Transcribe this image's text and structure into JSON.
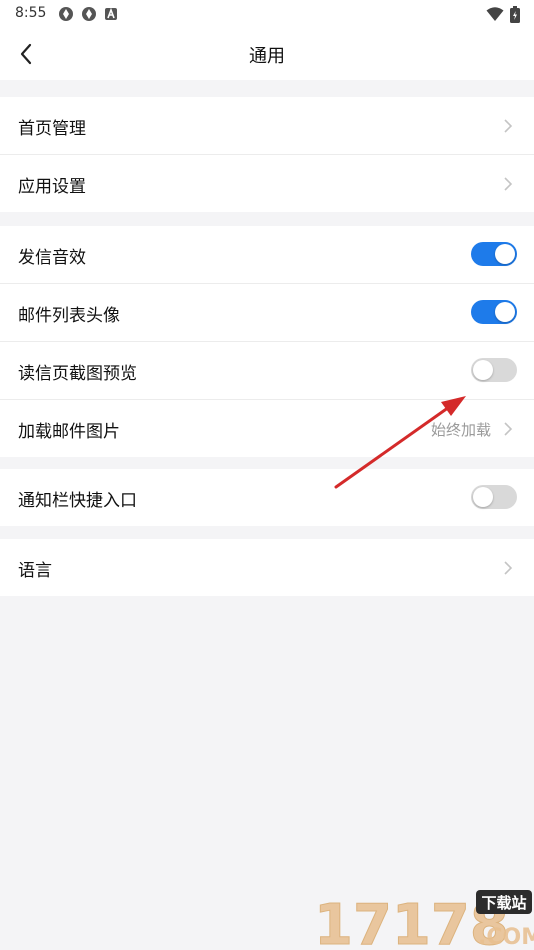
{
  "status_bar": {
    "time": "8:55",
    "left_icons": [
      "app-icon",
      "app-icon",
      "notification-a-icon"
    ],
    "right_icons": [
      "wifi-icon",
      "battery-icon"
    ]
  },
  "header": {
    "title": "通用",
    "back_icon": "chevron-left-icon"
  },
  "groups": [
    {
      "rows": [
        {
          "label": "首页管理",
          "type": "nav"
        },
        {
          "label": "应用设置",
          "type": "nav"
        }
      ]
    },
    {
      "rows": [
        {
          "label": "发信音效",
          "type": "toggle",
          "on": true
        },
        {
          "label": "邮件列表头像",
          "type": "toggle",
          "on": true
        },
        {
          "label": "读信页截图预览",
          "type": "toggle",
          "on": false
        },
        {
          "label": "加载邮件图片",
          "type": "nav",
          "value": "始终加载"
        }
      ]
    },
    {
      "rows": [
        {
          "label": "通知栏快捷入口",
          "type": "toggle",
          "on": false
        }
      ]
    },
    {
      "rows": [
        {
          "label": "语言",
          "type": "nav"
        }
      ]
    }
  ],
  "colors": {
    "toggle_on": "#1e7bea",
    "toggle_off": "#d9d9d9",
    "annotation_arrow": "#d42a2a"
  },
  "watermark": {
    "number": "17178",
    "badge": "下载站",
    "domain": ".COM"
  }
}
